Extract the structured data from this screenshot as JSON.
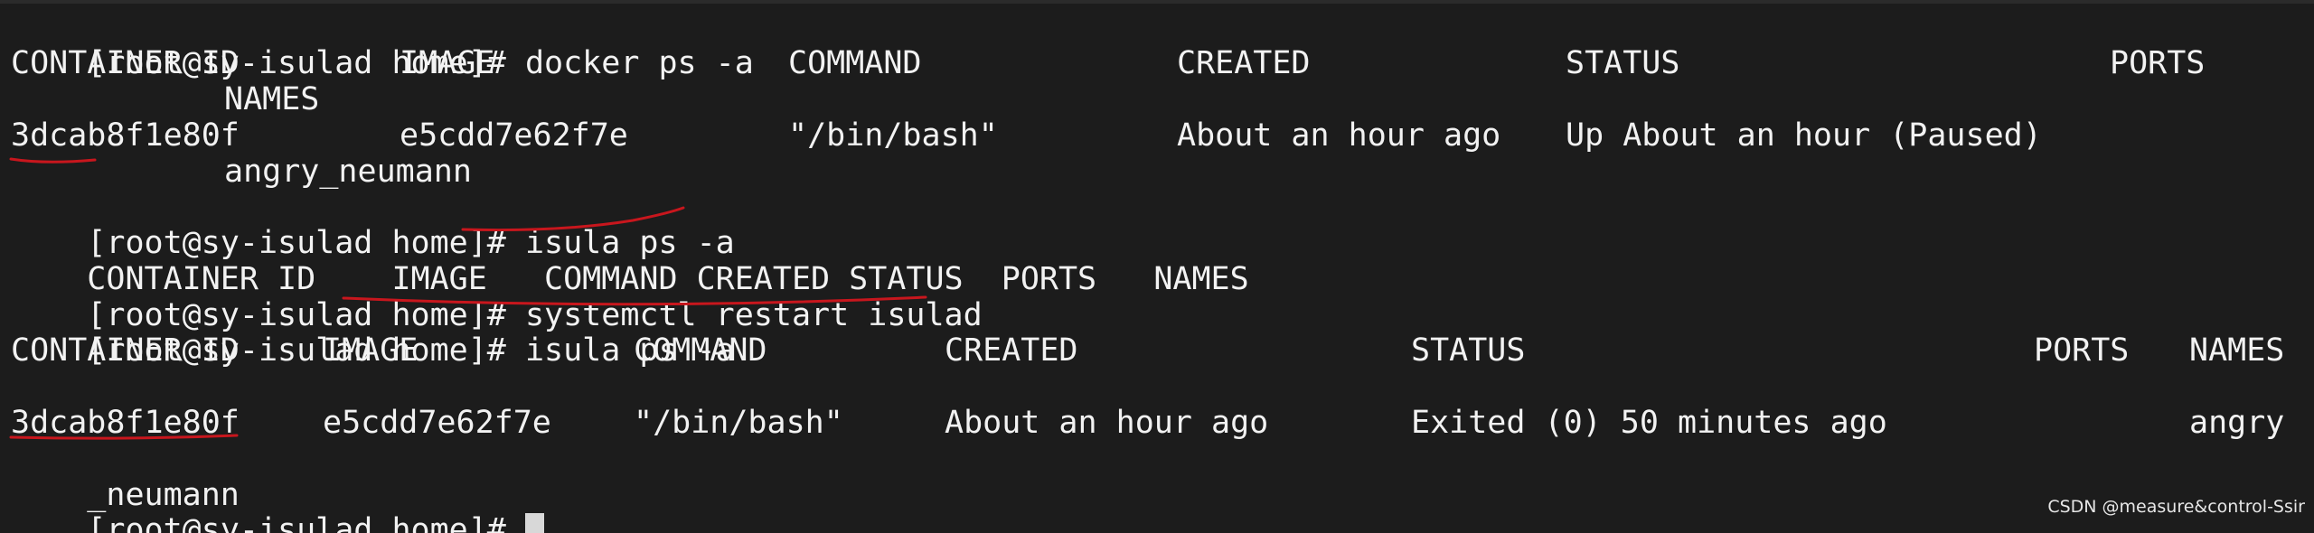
{
  "terminal": {
    "prompt": "[root@sy-isulad home]#",
    "cmd1": "docker ps -a",
    "docker_headers": [
      "CONTAINER ID",
      "IMAGE",
      "COMMAND",
      "CREATED",
      "STATUS",
      "PORTS",
      "NAMES"
    ],
    "docker_row": {
      "id": "3dcab8f1e80f",
      "image": "e5cdd7e62f7e",
      "command": "\"/bin/bash\"",
      "created": "About an hour ago",
      "status": "Up About an hour (Paused)",
      "names": "angry_neumann"
    },
    "cmd2": "isula ps -a",
    "isula_headers_empty": "CONTAINER ID    IMAGE   COMMAND CREATED STATUS  PORTS   NAMES",
    "cmd3": "systemctl restart isulad",
    "cmd4": "isula ps -a",
    "isula_headers": [
      "CONTAINER ID",
      "IMAGE",
      "COMMAND",
      "CREATED",
      "STATUS",
      "PORTS",
      "NAMES"
    ],
    "isula_row": {
      "id": "3dcab8f1e80f",
      "image": "e5cdd7e62f7e",
      "command": "\"/bin/bash\"",
      "created": "About an hour ago",
      "status": "Exited (0) 50 minutes ago",
      "names_part1": "angry",
      "names_part2": "_neumann"
    }
  },
  "annotation_color": "#c8161d",
  "cursor_color": "#d8d8d8",
  "watermark": "CSDN @measure&control-Ssir"
}
